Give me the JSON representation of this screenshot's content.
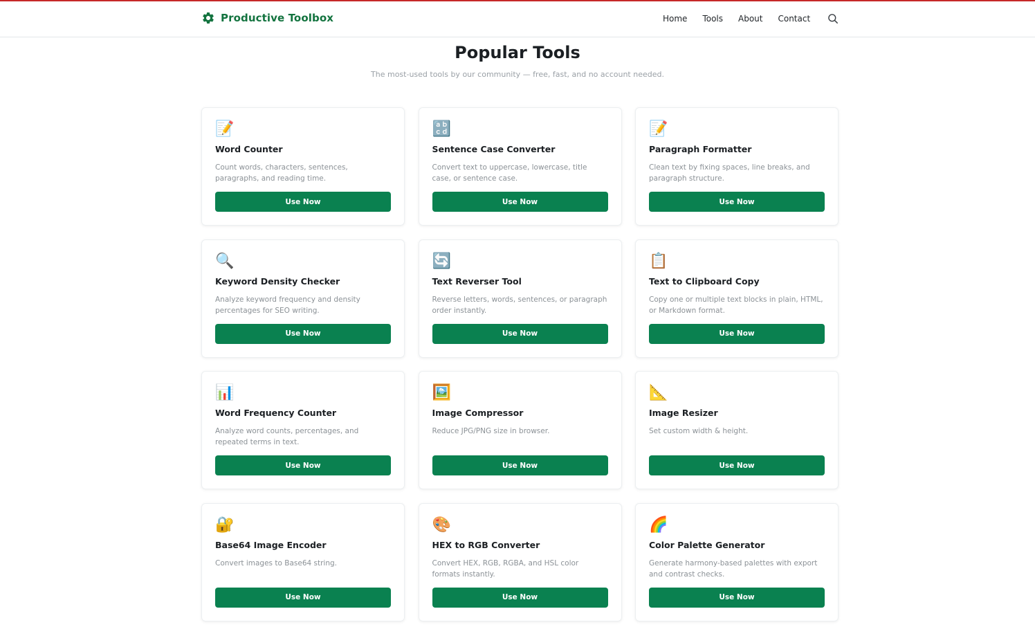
{
  "brand": {
    "name": "Productive Toolbox",
    "icon": "gear-icon",
    "color": "#13733f"
  },
  "nav": {
    "links": [
      "Home",
      "Tools",
      "About",
      "Contact"
    ],
    "search_icon": "search-icon"
  },
  "page": {
    "title": "Popular Tools",
    "subtitle": "The most-used tools by our community — free, fast, and no account needed."
  },
  "accent_color": "#0a8150",
  "tools": [
    {
      "icon": "📝",
      "icon_name": "memo-icon",
      "title": "Word Counter",
      "description": "Count words, characters, sentences, paragraphs, and reading time.",
      "button": "Use Now"
    },
    {
      "icon": "🔡",
      "icon_name": "abcd-letters-icon",
      "title": "Sentence Case Converter",
      "description": "Convert text to uppercase, lowercase, title case, or sentence case.",
      "button": "Use Now"
    },
    {
      "icon": "📝",
      "icon_name": "memo-icon",
      "title": "Paragraph Formatter",
      "description": "Clean text by fixing spaces, line breaks, and paragraph structure.",
      "button": "Use Now"
    },
    {
      "icon": "🔍",
      "icon_name": "magnifier-icon",
      "title": "Keyword Density Checker",
      "description": "Analyze keyword frequency and density percentages for SEO writing.",
      "button": "Use Now"
    },
    {
      "icon": "🔄",
      "icon_name": "reverse-arrows-icon",
      "title": "Text Reverser Tool",
      "description": "Reverse letters, words, sentences, or paragraph order instantly.",
      "button": "Use Now"
    },
    {
      "icon": "📋",
      "icon_name": "clipboard-icon",
      "title": "Text to Clipboard Copy",
      "description": "Copy one or multiple text blocks in plain, HTML, or Markdown format.",
      "button": "Use Now"
    },
    {
      "icon": "📊",
      "icon_name": "bar-chart-icon",
      "title": "Word Frequency Counter",
      "description": "Analyze word counts, percentages, and repeated terms in text.",
      "button": "Use Now"
    },
    {
      "icon": "🖼️",
      "icon_name": "framed-picture-icon",
      "title": "Image Compressor",
      "description": "Reduce JPG/PNG size in browser.",
      "button": "Use Now"
    },
    {
      "icon": "📐",
      "icon_name": "triangular-ruler-icon",
      "title": "Image Resizer",
      "description": "Set custom width & height.",
      "button": "Use Now"
    },
    {
      "icon": "🔐",
      "icon_name": "lock-with-key-icon",
      "title": "Base64 Image Encoder",
      "description": "Convert images to Base64 string.",
      "button": "Use Now"
    },
    {
      "icon": "🎨",
      "icon_name": "palette-icon",
      "title": "HEX to RGB Converter",
      "description": "Convert HEX, RGB, RGBA, and HSL color formats instantly.",
      "button": "Use Now"
    },
    {
      "icon": "🌈",
      "icon_name": "rainbow-icon",
      "title": "Color Palette Generator",
      "description": "Generate harmony-based palettes with export and contrast checks.",
      "button": "Use Now"
    }
  ]
}
